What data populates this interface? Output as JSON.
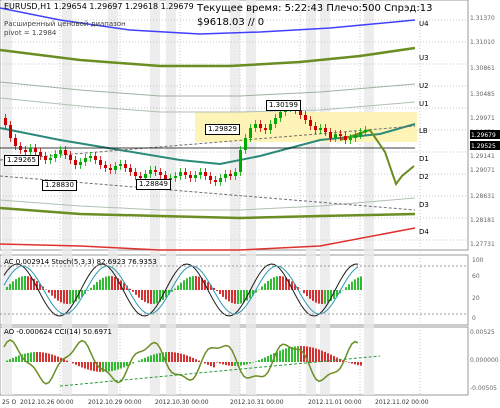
{
  "header": {
    "symbol_line": "EURUSD,H1  1.29654 1.29697 1.29618 1.29679",
    "caption_line1": "Расширенный ценовой диапазон",
    "caption_line2": "pivot = 1.2984",
    "time_line": "Текущее время: 5:22:43 Плечо:500 Спрэд:13",
    "balance_line": "$9618.03     // 0"
  },
  "channel_labels": [
    "U4",
    "U3",
    "U2",
    "U1",
    "LB",
    "D1",
    "D2",
    "D3",
    "D4"
  ],
  "price_axis": [
    "1.31370",
    "1.31010",
    "1.30861",
    "1.30485",
    "1.29971",
    "1.29679",
    "1.29525",
    "1.29141",
    "1.29071",
    "1.28631",
    "1.28181",
    "1.27731"
  ],
  "price_tags": [
    "1.30199",
    "1.29829",
    "1.29265",
    "1.28830",
    "1.28849"
  ],
  "current_price": {
    "value": "1.29679",
    "color": "#000000"
  },
  "bid_price": {
    "value": "1.29525",
    "color": "#000000"
  },
  "ac_panel": {
    "title": "AC 0.002914  Stoch(5,3,3) 82.6923 76.9353",
    "axis": [
      "100",
      "60",
      "20",
      "0"
    ]
  },
  "ao_panel": {
    "title": "AO -0.000624  CCI(14) 50.6971",
    "axis": [
      "0.00525",
      "0.000000",
      "-0.00505"
    ]
  },
  "time_axis": [
    "25 O",
    "2012.10.26 00:00",
    "2012.10.29 00:00",
    "2012.10.30 00:00",
    "2012.10.31 00:00",
    "2012.11.01 00:00",
    "2012.11.02 00:00"
  ],
  "colors": {
    "bull": "#00aa00",
    "bear": "#cc0000",
    "band_green": "#6b8e23",
    "band_blue": "#4040ff",
    "band_red": "#e03030",
    "ma_teal": "#2a8a7a",
    "highlight": "#fff3b0",
    "grid": "#c8c8c8"
  }
}
